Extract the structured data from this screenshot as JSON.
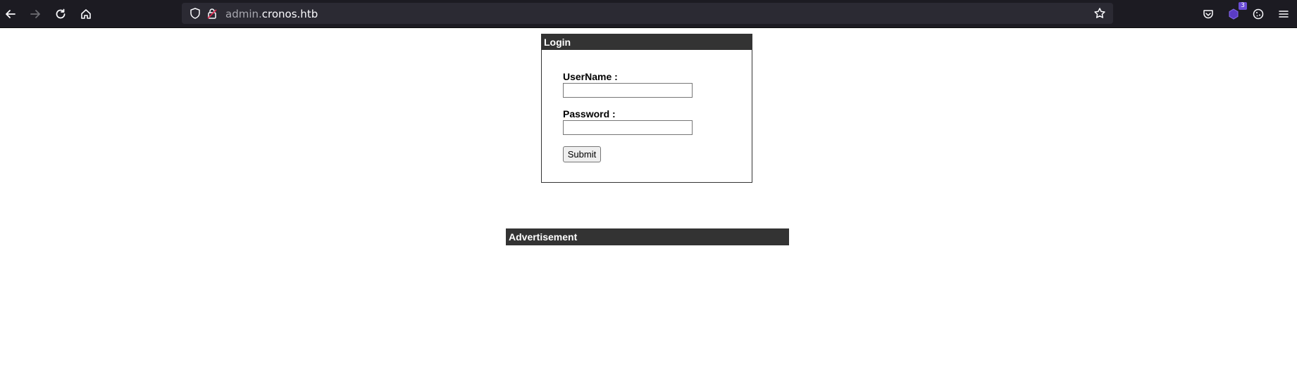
{
  "browser": {
    "url_subdomain": "admin.",
    "url_domain": "cronos.htb",
    "extension_badge": "3",
    "icons": [
      "back-arrow-icon",
      "forward-arrow-icon",
      "reload-icon",
      "home-icon",
      "shield-icon",
      "lock-icon",
      "star-icon",
      "pocket-icon",
      "extension-icon",
      "cookie-icon",
      "menu-icon"
    ]
  },
  "login": {
    "title": "Login",
    "username_label": "UserName :",
    "password_label": "Password :",
    "submit_label": "Submit"
  },
  "advertisement": {
    "title": "Advertisement"
  }
}
